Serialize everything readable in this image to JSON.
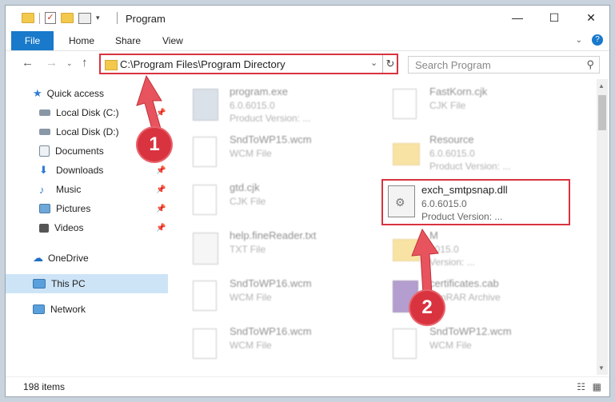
{
  "window": {
    "title": "Program"
  },
  "ribbon": {
    "file": "File",
    "tabs": [
      "Home",
      "Share",
      "View"
    ]
  },
  "address": {
    "path": "C:\\Program Files\\Program Directory"
  },
  "search": {
    "placeholder": "Search Program"
  },
  "sidebar": {
    "items": [
      {
        "label": "Quick access",
        "icon": "star-icon"
      },
      {
        "label": "Local Disk (C:)",
        "icon": "drive-icon"
      },
      {
        "label": "Local Disk (D:)",
        "icon": "drive-icon"
      },
      {
        "label": "Documents",
        "icon": "documents-icon"
      },
      {
        "label": "Downloads",
        "icon": "downloads-icon"
      },
      {
        "label": "Music",
        "icon": "music-icon"
      },
      {
        "label": "Pictures",
        "icon": "pictures-icon"
      },
      {
        "label": "Videos",
        "icon": "videos-icon"
      },
      {
        "label": "OneDrive",
        "icon": "cloud-icon"
      },
      {
        "label": "This PC",
        "icon": "computer-icon"
      },
      {
        "label": "Network",
        "icon": "network-icon"
      }
    ]
  },
  "files": [
    {
      "name": "program.exe",
      "line1": "6.0.6015.0",
      "line2": "Product Version:     ..."
    },
    {
      "name": "FastKorn.cjk",
      "line1": "CJK File",
      "line2": ""
    },
    {
      "name": "SndToWP15.wcm",
      "line1": "WCM File",
      "line2": ""
    },
    {
      "name": "Resource",
      "line1": "6.0.6015.0",
      "line2": "Product Version:     ..."
    },
    {
      "name": "gtd.cjk",
      "line1": "CJK File",
      "line2": ""
    },
    {
      "name": "help.fineReader.txt",
      "line1": "TXT File",
      "line2": ""
    },
    {
      "name": "M",
      "line1": "6015.0",
      "line2": "Version:     ..."
    },
    {
      "name": "SndToWP16.wcm",
      "line1": "WCM File",
      "line2": ""
    },
    {
      "name": "certificates.cab",
      "line1": "WinRAR Archive",
      "line2": ""
    },
    {
      "name": "SndToWP16.wcm",
      "line1": "WCM File",
      "line2": ""
    },
    {
      "name": "SndToWP12.wcm",
      "line1": "WCM File",
      "line2": ""
    }
  ],
  "highlighted": {
    "name": "exch_smtpsnap.dll",
    "line1": "6.0.6015.0",
    "line2": "Product Version:     ..."
  },
  "status": {
    "count": "198 items"
  },
  "annotations": {
    "step1": "1",
    "step2": "2"
  },
  "colors": {
    "accent": "#1979ca",
    "annotation": "#d9333f",
    "folder": "#f2c94c"
  }
}
